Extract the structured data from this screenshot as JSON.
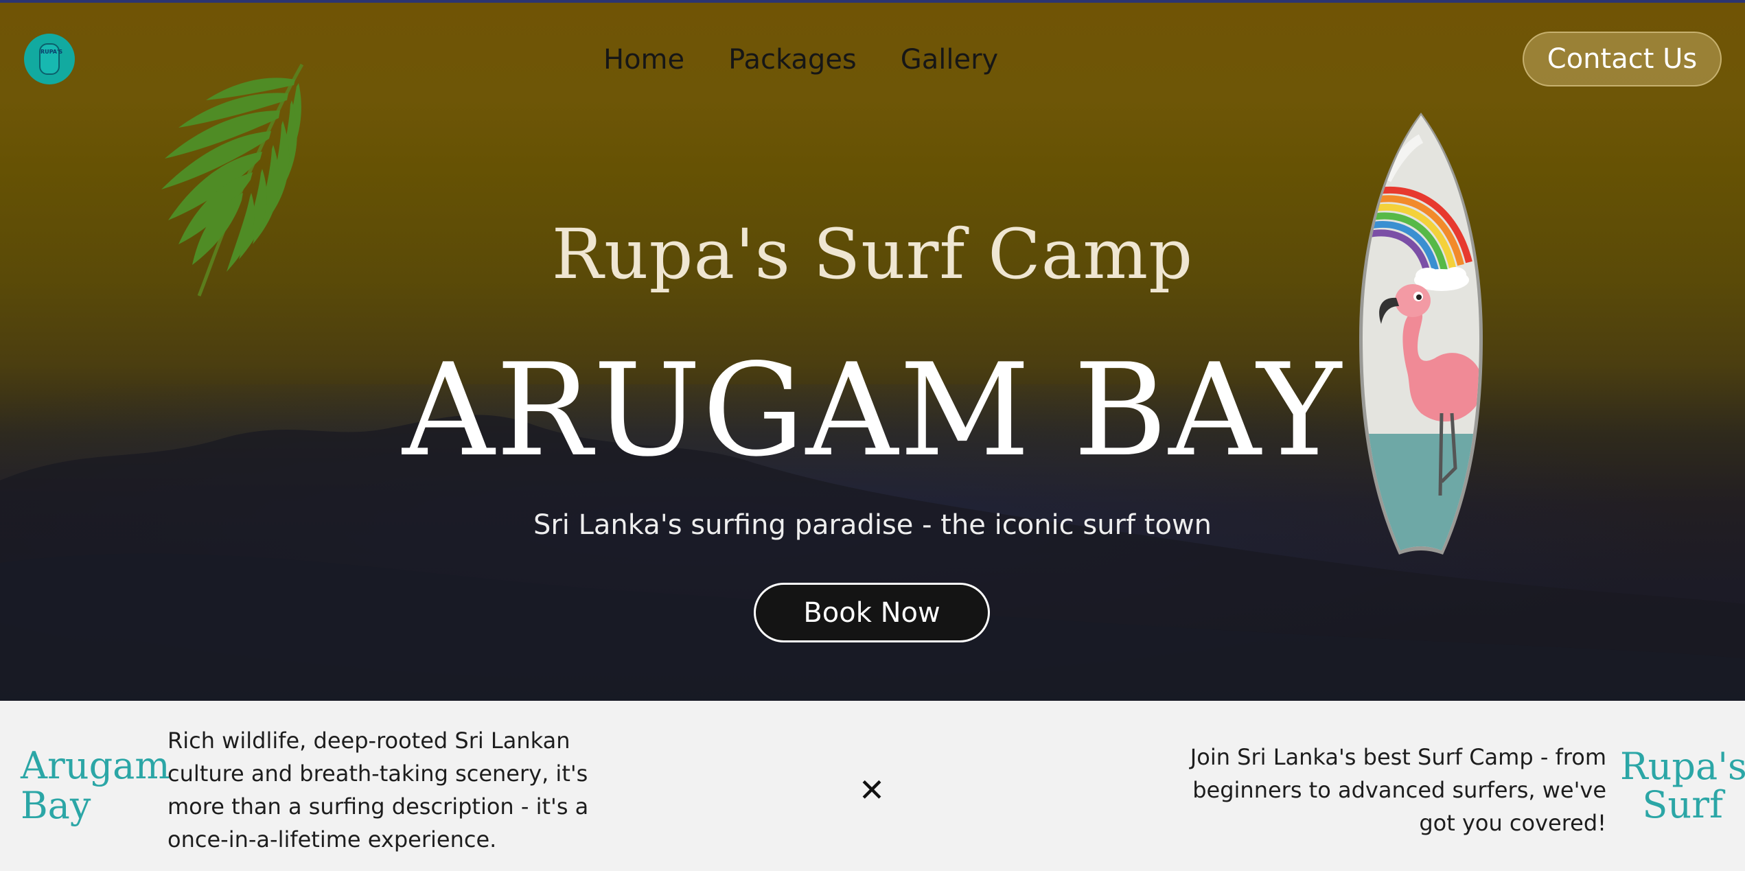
{
  "nav": {
    "logo_alt": "Rupa's Surf logo",
    "logo_text": "RUPA'S",
    "items": [
      {
        "label": "Home"
      },
      {
        "label": "Packages"
      },
      {
        "label": "Gallery"
      }
    ],
    "contact_label": "Contact Us"
  },
  "hero": {
    "subtitle": "Rupa's Surf Camp",
    "title": "ARUGAM BAY",
    "tagline": "Sri Lanka's surfing paradise - the iconic surf town",
    "cta_label": "Book Now"
  },
  "banner": {
    "brand_left_line1": "Arugam",
    "brand_left_line2": "Bay",
    "text_left": "Rich wildlife, deep-rooted Sri Lankan culture and breath-taking scenery, it's more than a surfing description - it's a once-in-a-lifetime experience.",
    "close_symbol": "✕",
    "text_right": "Join Sri Lanka's best Surf Camp - from beginners to advanced surfers, we've got you covered!",
    "brand_right_line1": "Rupa's",
    "brand_right_line2": "Surf"
  },
  "colors": {
    "accent": "#2ba6a6",
    "logo_bg": "#12aaa0",
    "hero_top": "#705405",
    "hero_bottom": "#171823"
  },
  "icons": {
    "logo": "surfboard-logo-icon",
    "leaf": "palm-leaf-illustration",
    "surfboard": "flamingo-surfboard-illustration",
    "close": "close-icon"
  }
}
